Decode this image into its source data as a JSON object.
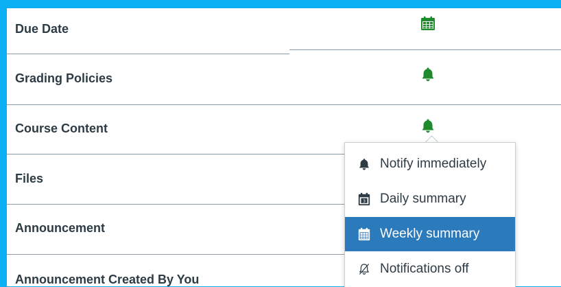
{
  "colors": {
    "accent_green": "#1e8a2c",
    "selected_blue": "#2b7abc",
    "frame_blue": "#0aaef2",
    "label_text": "#2d3b45"
  },
  "categories": [
    {
      "label": "Due Date",
      "icon": "calendar-week-icon"
    },
    {
      "label": "Grading Policies",
      "icon": "bell-icon"
    },
    {
      "label": "Course Content",
      "icon": "bell-icon"
    },
    {
      "label": "Files",
      "icon": ""
    },
    {
      "label": "Announcement",
      "icon": ""
    },
    {
      "label": "Announcement Created By You",
      "icon": ""
    }
  ],
  "menu": {
    "items": [
      {
        "label": "Notify immediately",
        "icon": "bell-icon",
        "selected": false
      },
      {
        "label": "Daily summary",
        "icon": "calendar-day-icon",
        "selected": false
      },
      {
        "label": "Weekly summary",
        "icon": "calendar-week-icon",
        "selected": true
      },
      {
        "label": "Notifications off",
        "icon": "bell-off-icon",
        "selected": false
      }
    ]
  }
}
